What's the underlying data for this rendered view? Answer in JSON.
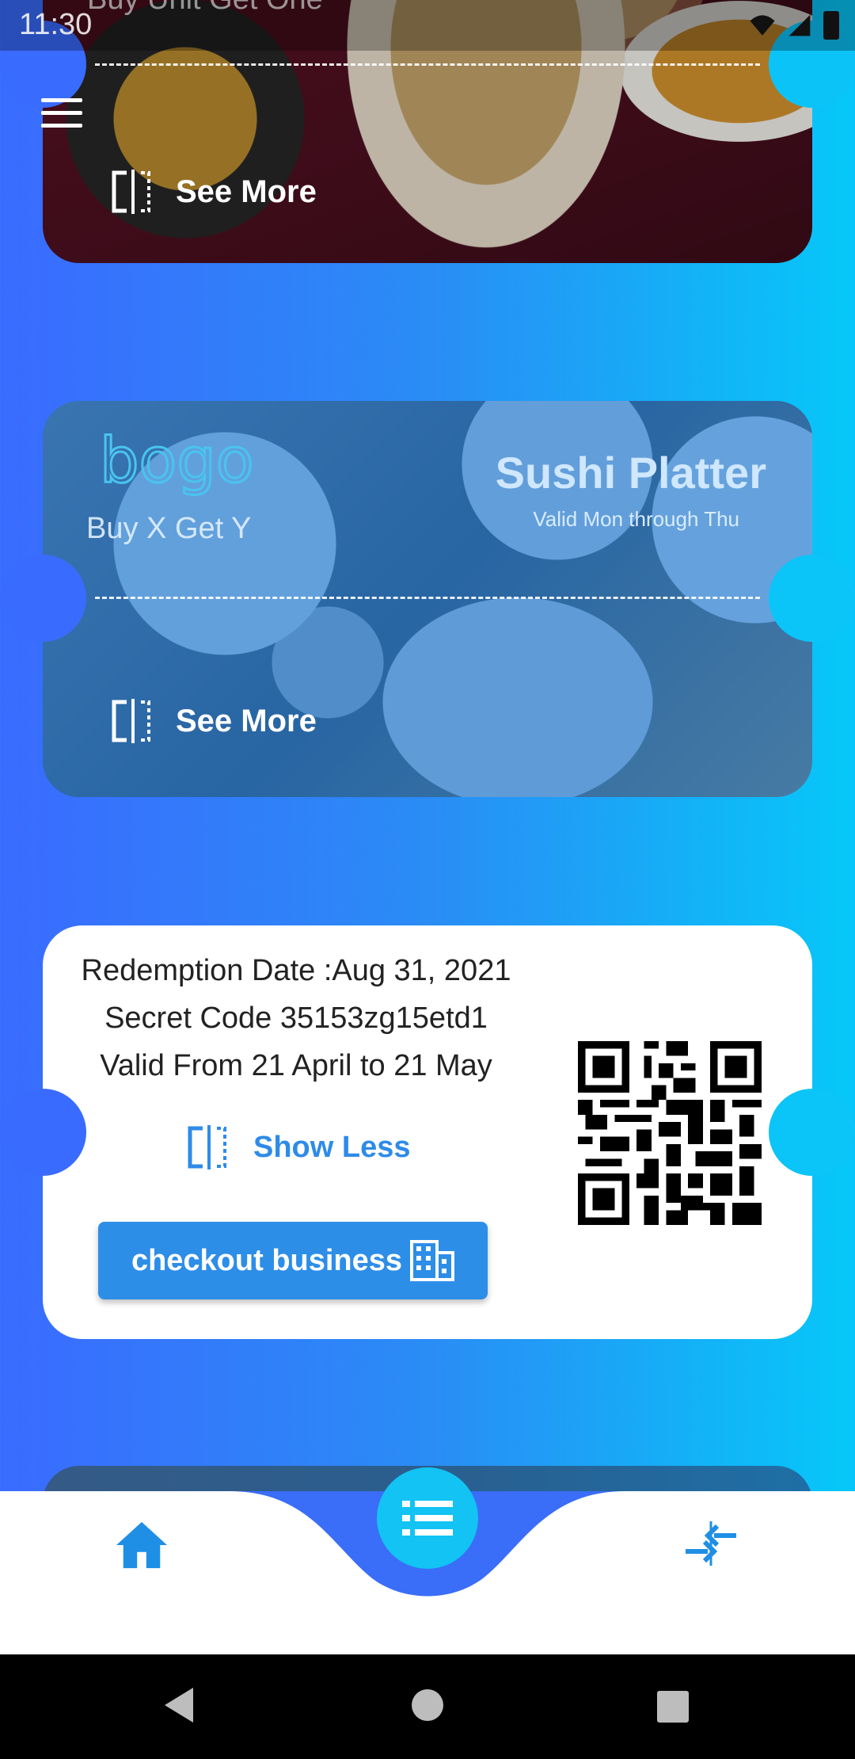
{
  "status_bar": {
    "time": "11:30"
  },
  "card1": {
    "subtitle": "Buy Unit Get One",
    "see_more_label": "See More"
  },
  "card2": {
    "logo_text": "bogo",
    "subtitle": "Buy X Get Y",
    "title": "Sushi Platter",
    "valid_text": "Valid Mon through Thu",
    "see_more_label": "See More"
  },
  "card3": {
    "redemption_date": "Redemption Date :Aug 31, 2021",
    "secret_code": "Secret Code 35153zg15etd1",
    "valid_range": "Valid From 21 April to 21 May",
    "show_less_label": "Show Less",
    "checkout_label": "checkout business"
  },
  "bottom_nav": {
    "home_icon": "home-icon",
    "center_icon": "list-icon",
    "compare_icon": "compare-arrows-icon"
  },
  "colors": {
    "bg_left": "#3a6bff",
    "bg_right": "#06c8f8",
    "accent": "#2d8ee8",
    "fab": "#12c3f4"
  }
}
